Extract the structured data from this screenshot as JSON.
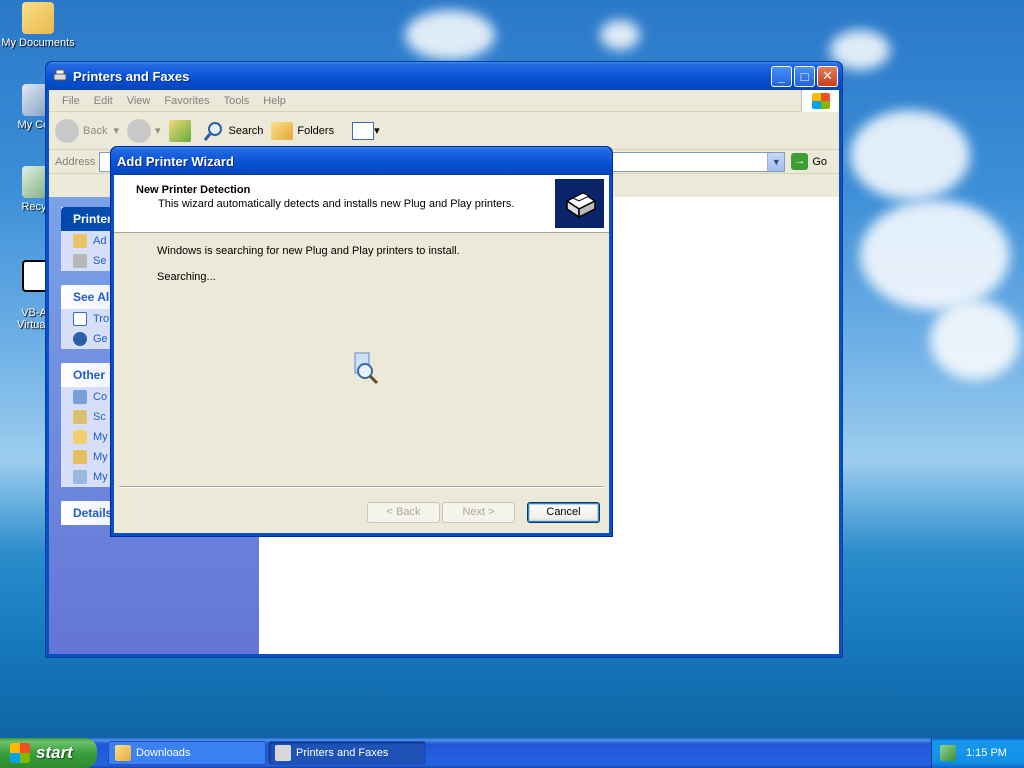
{
  "desktop": {
    "icons": [
      {
        "label": "My Documents"
      },
      {
        "label": "My Com"
      },
      {
        "label": "Recycl"
      },
      {
        "label": "VB-AU\nVirtual C"
      }
    ]
  },
  "explorer": {
    "title": "Printers and Faxes",
    "menu": [
      "File",
      "Edit",
      "View",
      "Favorites",
      "Tools",
      "Help"
    ],
    "toolbar": {
      "back": "Back",
      "search": "Search",
      "folders": "Folders"
    },
    "address": {
      "label": "Address",
      "go": "Go"
    },
    "taskpane": {
      "printer_tasks": {
        "title": "Printer",
        "items": [
          "Ad",
          "Se"
        ]
      },
      "see_also": {
        "title": "See Al",
        "items": [
          "Tro",
          "Ge"
        ]
      },
      "other_places": {
        "title": "Other",
        "items": [
          "Co",
          "Sc",
          "My",
          "My",
          "My"
        ]
      },
      "details": {
        "title": "Details"
      }
    }
  },
  "wizard": {
    "title": "Add Printer Wizard",
    "header_title": "New Printer Detection",
    "header_subtitle": "This wizard automatically detects and installs new Plug and Play printers.",
    "message": "Windows is searching for new Plug and Play printers to install.",
    "status": "Searching...",
    "buttons": {
      "back": "< Back",
      "next": "Next >",
      "cancel": "Cancel"
    }
  },
  "taskbar": {
    "start": "start",
    "items": [
      {
        "label": "Downloads"
      },
      {
        "label": "Printers and Faxes"
      }
    ],
    "clock": "1:15 PM"
  }
}
